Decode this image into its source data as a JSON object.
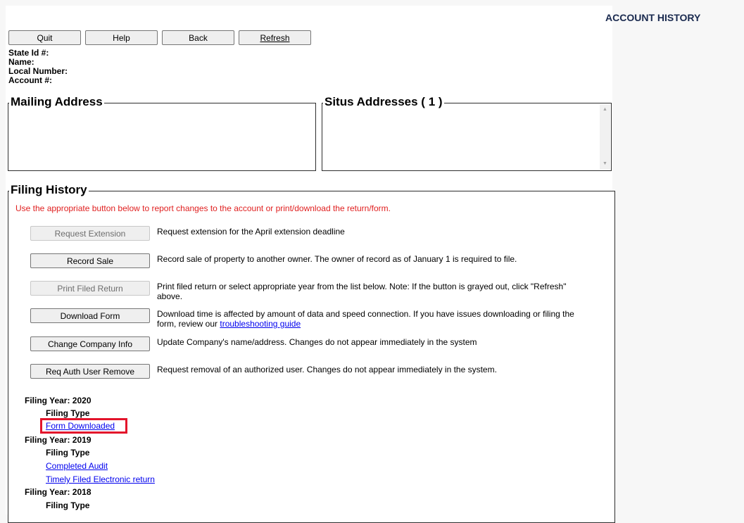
{
  "header": {
    "title": "ACCOUNT HISTORY"
  },
  "toolbar": {
    "quit": "Quit",
    "help": "Help",
    "back": "Back",
    "refresh": "Refresh"
  },
  "account": {
    "state_id_label": "State Id #:",
    "name_label": "Name:",
    "local_number_label": "Local Number:",
    "account_label": "Account #:"
  },
  "mailing_address": {
    "legend": "Mailing Address"
  },
  "situs_addresses": {
    "legend": "Situs Addresses ( 1 )"
  },
  "filing_history": {
    "legend": "Filing History",
    "instruction": "Use the appropriate button below to report changes to the account or print/download the return/form.",
    "actions": [
      {
        "label": "Request Extension",
        "desc": "Request extension for the April extension deadline",
        "disabled": true
      },
      {
        "label": "Record Sale",
        "desc": "Record sale of property to another owner. The owner of record as of January 1 is required to file.",
        "disabled": false
      },
      {
        "label": "Print Filed Return",
        "desc": "Print filed return or select appropriate year from the list below. Note: If the button is grayed out, click \"Refresh\" above.",
        "disabled": true
      },
      {
        "label": "Download Form",
        "desc": "Download time is affected by amount of data and speed connection. If you have issues downloading or filing the form, review our",
        "link": "troubleshooting guide",
        "disabled": false
      },
      {
        "label": "Change Company Info",
        "desc": "Update Company's name/address. Changes do not appear immediately in the system",
        "disabled": false
      },
      {
        "label": "Req Auth User Remove",
        "desc": "Request removal of an authorized user. Changes do not appear immediately in the system.",
        "disabled": false
      }
    ],
    "years": [
      {
        "year_label": "Filing Year: 2020",
        "type_label": "Filing Type",
        "links": [
          "Form Downloaded"
        ]
      },
      {
        "year_label": "Filing Year: 2019",
        "type_label": "Filing Type",
        "links": [
          "Completed Audit",
          "Timely Filed Electronic return"
        ]
      },
      {
        "year_label": "Filing Year: 2018",
        "type_label": "Filing Type",
        "links": []
      }
    ]
  },
  "colors": {
    "instruction": "#e02020",
    "link": "#0000ee",
    "highlight": "#e3142b",
    "title": "#1a2a4f"
  }
}
